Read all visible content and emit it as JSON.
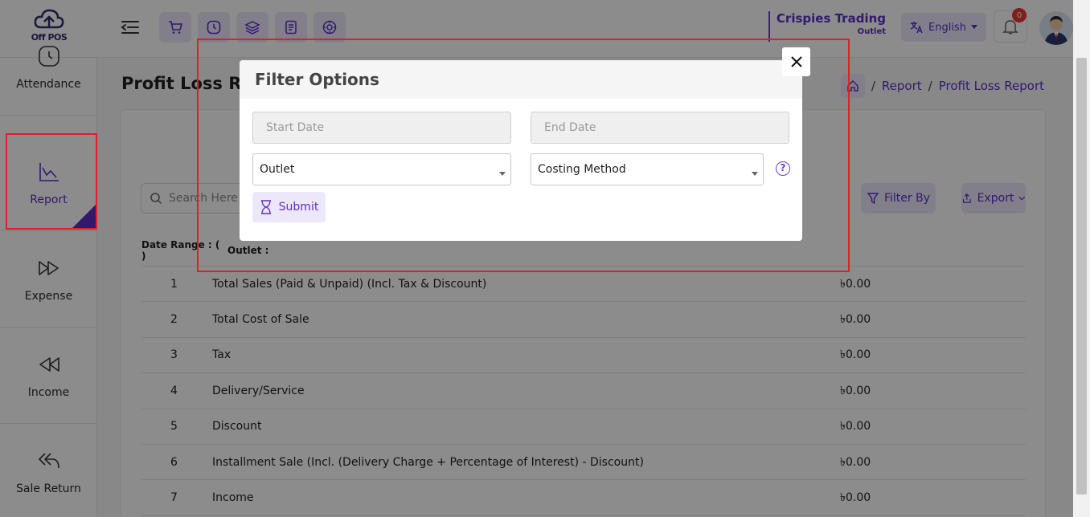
{
  "app": {
    "logo_text": "Off POS",
    "company_name": "Crispies Trading",
    "company_sub": "Outlet",
    "language": "English",
    "notifications_count": "0"
  },
  "sidebar": {
    "items": [
      {
        "label": "Attendance",
        "icon": "clock-icon"
      },
      {
        "label": "Report",
        "icon": "chart-icon"
      },
      {
        "label": "Expense",
        "icon": "fast-forward-icon"
      },
      {
        "label": "Income",
        "icon": "rewind-icon"
      },
      {
        "label": "Sale Return",
        "icon": "reply-all-icon"
      }
    ]
  },
  "page": {
    "title": "Profit Loss Rep",
    "breadcrumb": {
      "sep": "/",
      "report": "Report",
      "current": "Profit Loss Report"
    }
  },
  "toolbar": {
    "search_placeholder": "Search Here",
    "filter_label": "Filter By",
    "export_label": "Export"
  },
  "table": {
    "header": {
      "date_range": "Date Range : ( )",
      "outlet": "Outlet :"
    },
    "rows": [
      {
        "sn": "1",
        "name": "Total Sales (Paid & Unpaid) (Incl. Tax & Discount)",
        "value": "৳0.00"
      },
      {
        "sn": "2",
        "name": "Total Cost of Sale",
        "value": "৳0.00"
      },
      {
        "sn": "3",
        "name": "Tax",
        "value": "৳0.00"
      },
      {
        "sn": "4",
        "name": "Delivery/Service",
        "value": "৳0.00"
      },
      {
        "sn": "5",
        "name": "Discount",
        "value": "৳0.00"
      },
      {
        "sn": "6",
        "name": "Installment Sale (Incl. (Delivery Charge + Percentage of Interest) - Discount)",
        "value": "৳0.00"
      },
      {
        "sn": "7",
        "name": "Income",
        "value": "৳0.00"
      }
    ]
  },
  "modal": {
    "title": "Filter Options",
    "start_date_placeholder": "Start Date",
    "end_date_placeholder": "End Date",
    "outlet_select": "Outlet",
    "costing_select": "Costing Method",
    "help_glyph": "?",
    "submit_label": "Submit",
    "close_glyph": "✕"
  },
  "colors": {
    "accent": "#5b2fc9",
    "accent_light": "#ede7fb",
    "highlight": "#e31e24"
  }
}
